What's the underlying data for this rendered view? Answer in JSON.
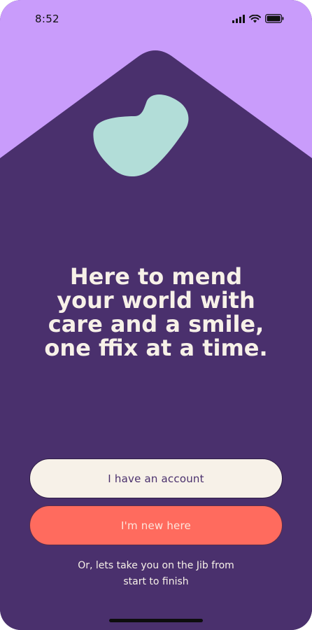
{
  "status_bar": {
    "time": "8:52",
    "icons": [
      "cellular-signal-icon",
      "wifi-icon",
      "battery-icon"
    ]
  },
  "brand": {
    "logo_icon": "blob-logo-icon"
  },
  "headline": {
    "lines": [
      "Here to mend",
      "your world with",
      "care and a smile,",
      "one ffix at a time."
    ]
  },
  "actions": {
    "existing_account_label": "I have an account",
    "new_user_label": "I'm new here"
  },
  "tour": {
    "lines": [
      "Or, lets take you on the Jib from",
      "start to finish"
    ]
  },
  "colors": {
    "lilac": "#c99cfb",
    "plum": "#4a306d",
    "mint": "#b2ddd8",
    "cream": "#f7f1e8",
    "coral": "#ff6b5e"
  }
}
